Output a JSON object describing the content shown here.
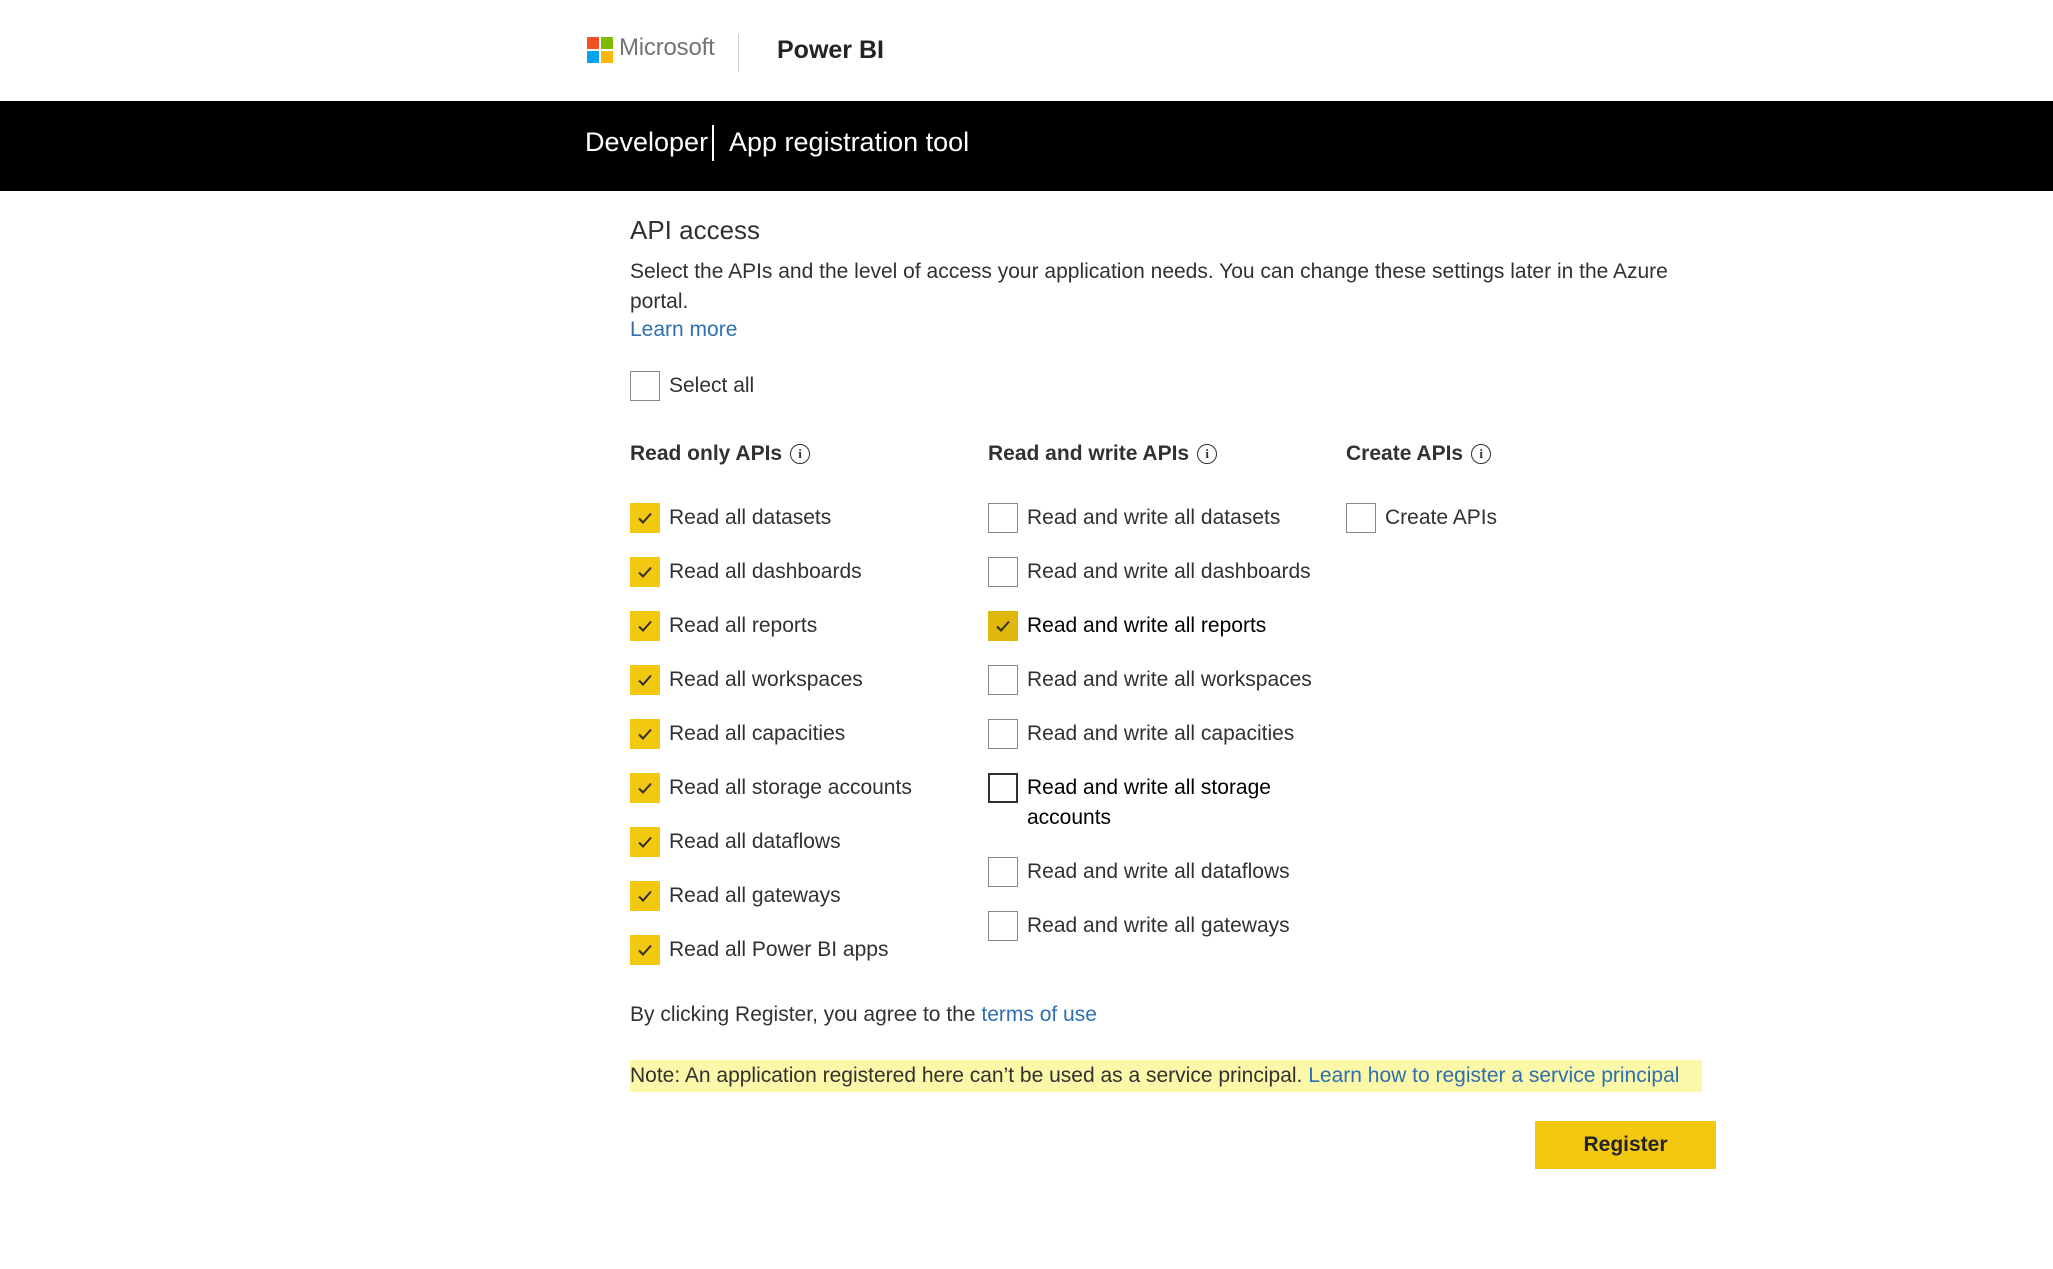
{
  "brand": {
    "company": "Microsoft",
    "product": "Power BI",
    "logo_colors": [
      "#f25022",
      "#7fba00",
      "#00a4ef",
      "#ffb900"
    ]
  },
  "header": {
    "section": "Developer",
    "title": "App registration tool"
  },
  "api_access": {
    "title": "API access",
    "description": "Select the APIs and the level of access your application needs. You can change these settings later in the Azure portal.",
    "learn_more": "Learn more",
    "select_all": {
      "label": "Select all",
      "checked": false
    }
  },
  "columns": {
    "read_only": {
      "heading": "Read only APIs",
      "items": [
        {
          "label": "Read all datasets",
          "checked": true
        },
        {
          "label": "Read all dashboards",
          "checked": true
        },
        {
          "label": "Read all reports",
          "checked": true
        },
        {
          "label": "Read all workspaces",
          "checked": true
        },
        {
          "label": "Read all capacities",
          "checked": true
        },
        {
          "label": "Read all storage accounts",
          "checked": true
        },
        {
          "label": "Read all dataflows",
          "checked": true
        },
        {
          "label": "Read all gateways",
          "checked": true
        },
        {
          "label": "Read all Power BI apps",
          "checked": true
        }
      ]
    },
    "read_write": {
      "heading": "Read and write APIs",
      "items": [
        {
          "label": "Read and write all datasets",
          "checked": false
        },
        {
          "label": "Read and write all dashboards",
          "checked": false
        },
        {
          "label": "Read and write all reports",
          "checked": true
        },
        {
          "label": "Read and write all workspaces",
          "checked": false
        },
        {
          "label": "Read and write all capacities",
          "checked": false
        },
        {
          "label": "Read and write all storage accounts",
          "checked": false
        },
        {
          "label": "Read and write all dataflows",
          "checked": false
        },
        {
          "label": "Read and write all gateways",
          "checked": false
        }
      ]
    },
    "create": {
      "heading": "Create APIs",
      "items": [
        {
          "label": "Create APIs",
          "checked": false
        }
      ]
    }
  },
  "info_glyph": "i",
  "terms": {
    "prefix": "By clicking Register, you agree to the",
    "link": "terms of use"
  },
  "note": {
    "text": "Note: An application registered here can’t be used as a service principal.",
    "link": "Learn how to register a service principal"
  },
  "register_button": "Register",
  "colors": {
    "accent_yellow": "#f2c811",
    "link_blue": "#2d6fb0",
    "note_highlight": "#fbf8a9",
    "header_bg": "#000000"
  }
}
